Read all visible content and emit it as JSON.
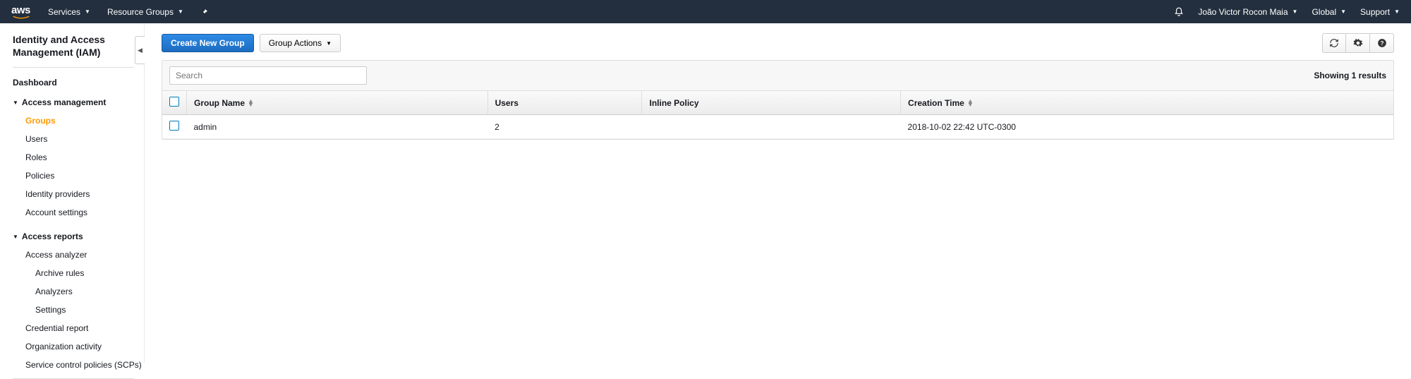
{
  "topnav": {
    "logo": "aws",
    "services": "Services",
    "resource_groups": "Resource Groups",
    "user": "João Victor Rocon Maia",
    "region": "Global",
    "support": "Support"
  },
  "sidebar": {
    "title": "Identity and Access Management (IAM)",
    "dashboard": "Dashboard",
    "sections": [
      {
        "header": "Access management",
        "items": [
          {
            "label": "Groups",
            "active": true
          },
          {
            "label": "Users"
          },
          {
            "label": "Roles"
          },
          {
            "label": "Policies"
          },
          {
            "label": "Identity providers"
          },
          {
            "label": "Account settings"
          }
        ]
      },
      {
        "header": "Access reports",
        "items": [
          {
            "label": "Access analyzer"
          },
          {
            "label": "Archive rules",
            "nested": true
          },
          {
            "label": "Analyzers",
            "nested": true
          },
          {
            "label": "Settings",
            "nested": true
          },
          {
            "label": "Credential report"
          },
          {
            "label": "Organization activity"
          },
          {
            "label": "Service control policies (SCPs)"
          }
        ]
      }
    ]
  },
  "toolbar": {
    "create": "Create New Group",
    "actions": "Group Actions"
  },
  "search": {
    "placeholder": "Search"
  },
  "results_text": "Showing 1 results",
  "columns": {
    "group_name": "Group Name",
    "users": "Users",
    "inline_policy": "Inline Policy",
    "creation_time": "Creation Time"
  },
  "rows": [
    {
      "group_name": "admin",
      "users": "2",
      "inline_policy": "",
      "creation_time": "2018-10-02 22:42 UTC-0300"
    }
  ]
}
